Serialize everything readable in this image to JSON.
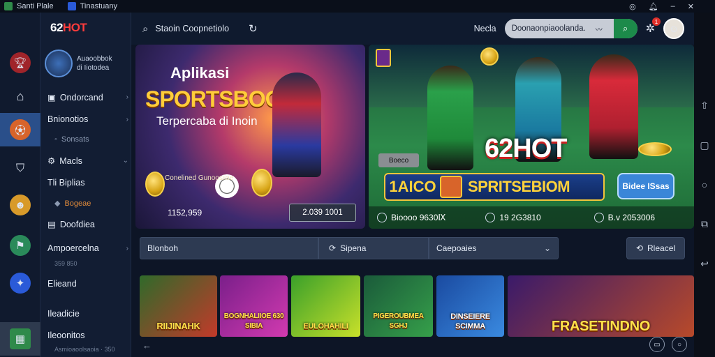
{
  "status_bar": {
    "app1": "Santi Plale",
    "app2": "Tinastuany",
    "icons": [
      "target-icon",
      "bell-icon",
      "minimize-icon",
      "close-icon"
    ]
  },
  "menu": {
    "logo_main": "62",
    "logo_accent": "HOT",
    "profile_line1": "Auaoobbok",
    "profile_line2": "di Iiotodea",
    "items": [
      {
        "label": "Ondorcand",
        "chev": "›"
      },
      {
        "label": "Bnionotios",
        "chev": "›"
      },
      {
        "label": "Sonsats",
        "chev": ""
      },
      {
        "label": "Macls",
        "chev": "⌄"
      },
      {
        "label": "Tli Biplias",
        "chev": ""
      },
      {
        "label": "Bogeae",
        "chev": ""
      },
      {
        "label": "Doofdiea",
        "chev": ""
      },
      {
        "label": "Ampoercelna",
        "chev": "›"
      },
      {
        "label": "Elieand",
        "chev": ""
      },
      {
        "label": "Ileadicie",
        "chev": ""
      },
      {
        "label": "Ileoonitos",
        "chev": ""
      }
    ],
    "meta1": "359 850",
    "meta2": "Asmioaoolsaoia · 350"
  },
  "topbar": {
    "search_label": "Staoin Coopnetiolo",
    "nav_label": "Necla",
    "pill_text": "Doonaonpiaoolanda.",
    "notif_count": "1"
  },
  "banner_left": {
    "title": "Aplikasi",
    "headline": "SPORTSBOOK",
    "subtitle": "Terpercaba di Inoin",
    "coin_label": "Conelined Gunoosiiae",
    "stat": "1152,959",
    "stat_box": "2.039 1001"
  },
  "banner_right": {
    "brand": "62HOT",
    "tag": "Boeco",
    "strip_left": "1AICO",
    "strip_right": "SPRITSEBIOM",
    "action": "Bidee ISsas",
    "stats": [
      "Bioooo 9630Ⅸ",
      "19 2G3810",
      "B.v 2053006"
    ]
  },
  "filters": {
    "f1": "Blonboh",
    "f2": "Sipena",
    "f3": "Caepoaies",
    "reload": "Rleacel"
  },
  "tiles": [
    {
      "label": "RIIJINAHK",
      "colors": [
        "#2f6a2a",
        "#c23a2a"
      ]
    },
    {
      "label": "BOGNHALIIOE 630 SIBIA",
      "colors": [
        "#7a1f8a",
        "#d23ab0"
      ]
    },
    {
      "label": "EULOHAHILI",
      "colors": [
        "#3aa02a",
        "#c8e02a"
      ]
    },
    {
      "label": "PIGEROUBMEA SGHJ",
      "colors": [
        "#1a5a3a",
        "#36a04a"
      ]
    },
    {
      "label": "DINSEIERE SCIMMA",
      "colors": [
        "#1a4aa0",
        "#3a8ae0"
      ]
    },
    {
      "label": "FRASETINDNO",
      "colors": [
        "#3a1a6a",
        "#b84a2a"
      ]
    }
  ]
}
